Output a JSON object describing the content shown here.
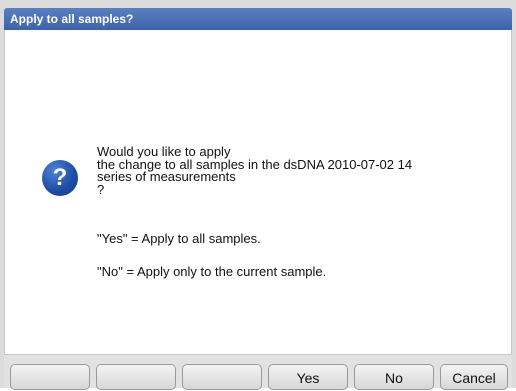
{
  "dialog": {
    "title": "Apply to all samples?",
    "icon": "question-icon",
    "icon_glyph": "?",
    "message_lines": [
      "Would you like to apply",
      "the change to all samples in the dsDNA 2010-07-02 14",
      "series of measurements",
      "?"
    ],
    "yes_explanation": "\"Yes\" = Apply to all samples.",
    "no_explanation": "\"No\" = Apply only to the current sample."
  },
  "buttons": {
    "slot1": "",
    "slot2": "",
    "slot3": "",
    "yes": "Yes",
    "no": "No",
    "cancel": "Cancel"
  },
  "colors": {
    "titlebar": "#3d62a8",
    "icon": "#1f4fa6"
  }
}
